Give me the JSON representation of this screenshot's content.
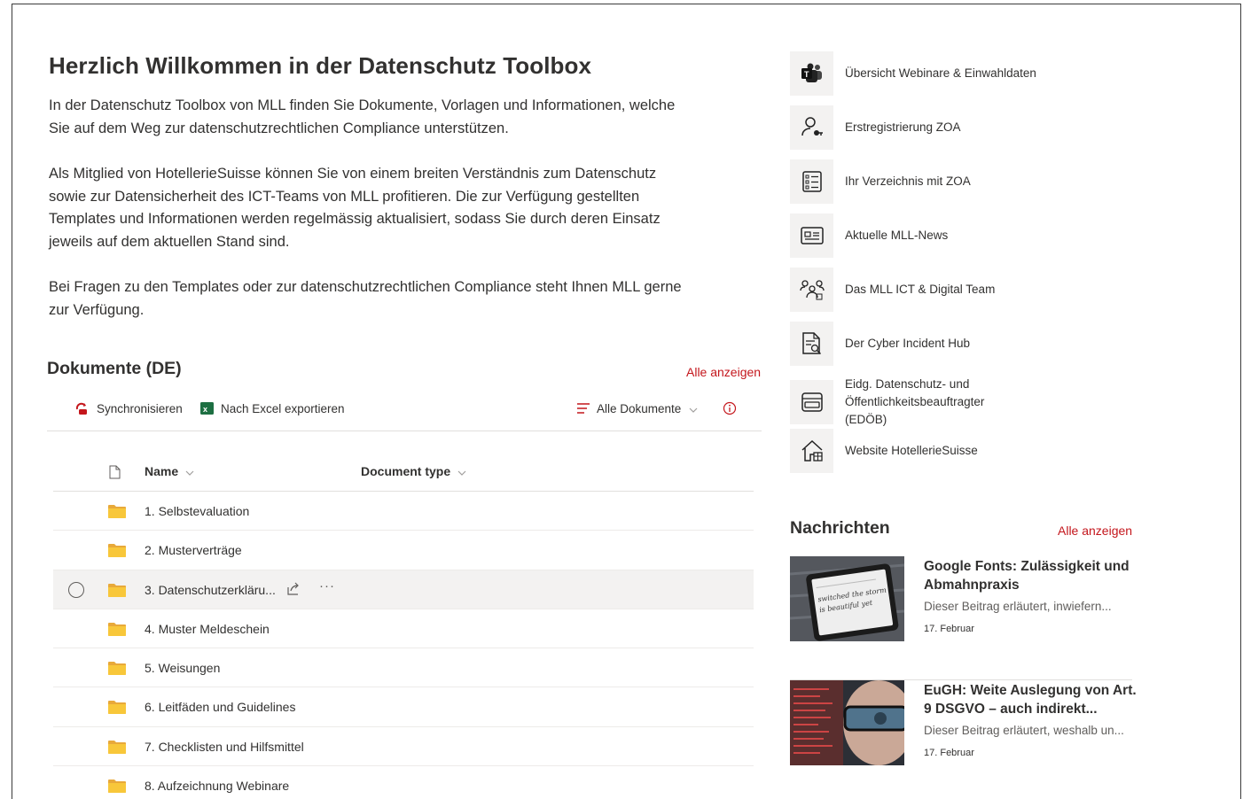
{
  "welcome": {
    "title": "Herzlich Willkommen in der Datenschutz Toolbox",
    "paragraphs": [
      "In der Datenschutz Toolbox von MLL finden Sie Dokumente, Vorlagen und Informationen, welche\nSie auf dem Weg zur datenschutzrechtlichen Compliance unterstützen.",
      "Als Mitglied von HotellerieSuisse können Sie von einem breiten Verständnis zum Datenschutz\nsowie zur Datensicherheit des ICT-Teams von MLL profitieren. Die zur Verfügung gestellten\nTemplates und Informationen werden regelmässig aktualisiert, sodass Sie durch deren Einsatz\njeweils auf dem aktuellen Stand sind.",
      "Bei Fragen zu den Templates oder zur datenschutzrechtlichen Compliance steht Ihnen MLL gerne\nzur Verfügung."
    ]
  },
  "documents": {
    "title": "Dokumente (DE)",
    "see_all": "Alle anzeigen",
    "commands": {
      "sync": "Synchronisieren",
      "export": "Nach Excel exportieren",
      "view": "Alle Dokumente"
    },
    "columns": {
      "name": "Name",
      "document_type": "Document type"
    },
    "rows": [
      {
        "name": "1. Selbstevaluation"
      },
      {
        "name": "2. Musterverträge"
      },
      {
        "name": "3. Datenschutzerkläru..."
      },
      {
        "name": "4. Muster Meldeschein"
      },
      {
        "name": "5. Weisungen"
      },
      {
        "name": "6. Leitfäden und Guidelines"
      },
      {
        "name": "7. Checklisten und Hilfsmittel"
      },
      {
        "name": "8. Aufzeichnung Webinare"
      }
    ]
  },
  "quick_links": [
    {
      "label": "Übersicht Webinare & Einwahldaten",
      "icon": "teams-icon"
    },
    {
      "label": "Erstregistrierung ZOA",
      "icon": "person-key-icon"
    },
    {
      "label": "Ihr Verzeichnis mit ZOA",
      "icon": "checklist-icon"
    },
    {
      "label": "Aktuelle MLL-News",
      "icon": "news-icon"
    },
    {
      "label": "Das MLL ICT & Digital Team",
      "icon": "people-team-icon"
    },
    {
      "label": "Der Cyber Incident Hub",
      "icon": "document-search-icon"
    },
    {
      "label": "Eidg. Datenschutz- und Öffentlichkeitsbeauftragter (EDÖB)",
      "icon": "card-icon"
    },
    {
      "label": "Website HotellerieSuisse",
      "icon": "home-icon"
    }
  ],
  "news": {
    "title": "Nachrichten",
    "see_all": "Alle anzeigen",
    "items": [
      {
        "headline": "Google Fonts: Zulässigkeit und Abmahnpraxis",
        "description": "Dieser Beitrag erläutert, inwiefern...",
        "date": "17. Februar",
        "thumb_text": "switched the storm is beautiful yet"
      },
      {
        "headline": "EuGH: Weite Auslegung von Art. 9 DSGVO – auch indirekt...",
        "description": "Dieser Beitrag erläutert, weshalb un...",
        "date": "17. Februar"
      }
    ]
  },
  "colors": {
    "accent_red": "#c4161c",
    "folder_yellow": "#f8c73a",
    "excel_green": "#1d6f42"
  }
}
